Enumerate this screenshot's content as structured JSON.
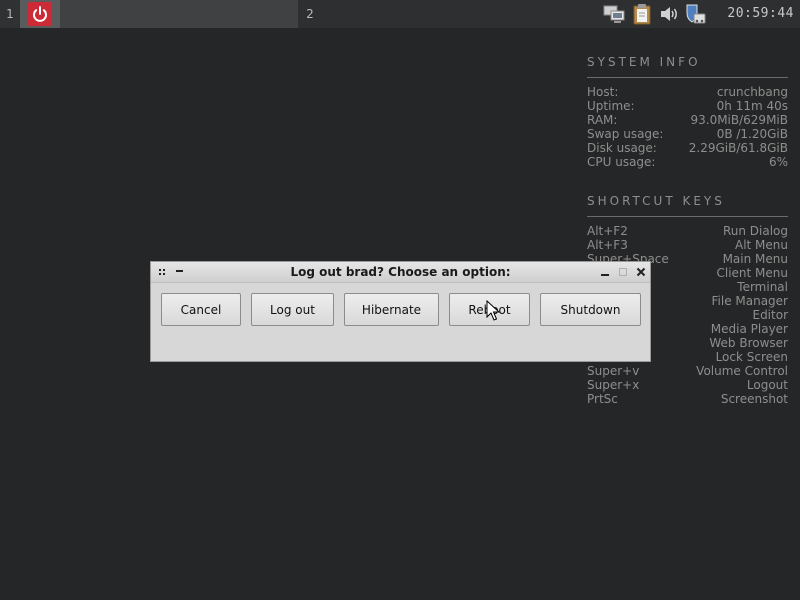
{
  "panel": {
    "workspace_1": "1",
    "workspace_2": "2",
    "active_task_icon": "power-icon",
    "tray_icons": [
      "network-icon",
      "clipboard-icon",
      "volume-icon",
      "update-manager-icon"
    ],
    "clock": "20:59:44"
  },
  "conky": {
    "system_heading": "SYSTEM INFO",
    "system_rows": [
      {
        "label": "Host:",
        "value": "crunchbang"
      },
      {
        "label": "Uptime:",
        "value": "0h 11m 40s"
      },
      {
        "label": "RAM:",
        "value": "93.0MiB/629MiB"
      },
      {
        "label": "Swap usage:",
        "value": "0B  /1.20GiB"
      },
      {
        "label": "Disk usage:",
        "value": "2.29GiB/61.8GiB"
      },
      {
        "label": "CPU usage:",
        "value": "6%"
      }
    ],
    "shortcut_heading": "SHORTCUT KEYS",
    "shortcut_rows": [
      {
        "key": "Alt+F2",
        "action": "Run Dialog"
      },
      {
        "key": "Alt+F3",
        "action": "Alt Menu"
      },
      {
        "key": "Super+Space",
        "action": "Main Menu"
      },
      {
        "key": "",
        "action": "Client Menu"
      },
      {
        "key": "",
        "action": "Terminal"
      },
      {
        "key": "",
        "action": "File Manager"
      },
      {
        "key": "",
        "action": "Editor"
      },
      {
        "key": "",
        "action": "Media Player"
      },
      {
        "key": "",
        "action": "Web Browser"
      },
      {
        "key": "",
        "action": "Lock Screen"
      },
      {
        "key": "Super+v",
        "action": "Volume Control"
      },
      {
        "key": "Super+x",
        "action": "Logout"
      },
      {
        "key": "PrtSc",
        "action": "Screenshot"
      }
    ]
  },
  "dialog": {
    "title": "Log out brad? Choose an option:",
    "buttons": {
      "cancel": "Cancel",
      "logout": "Log out",
      "hibernate": "Hibernate",
      "reboot": "Reboot",
      "shutdown": "Shutdown"
    }
  },
  "colors": {
    "desktop_bg": "#252627",
    "power_accent": "#cc2a36",
    "dialog_bg": "#d7d7d7"
  }
}
